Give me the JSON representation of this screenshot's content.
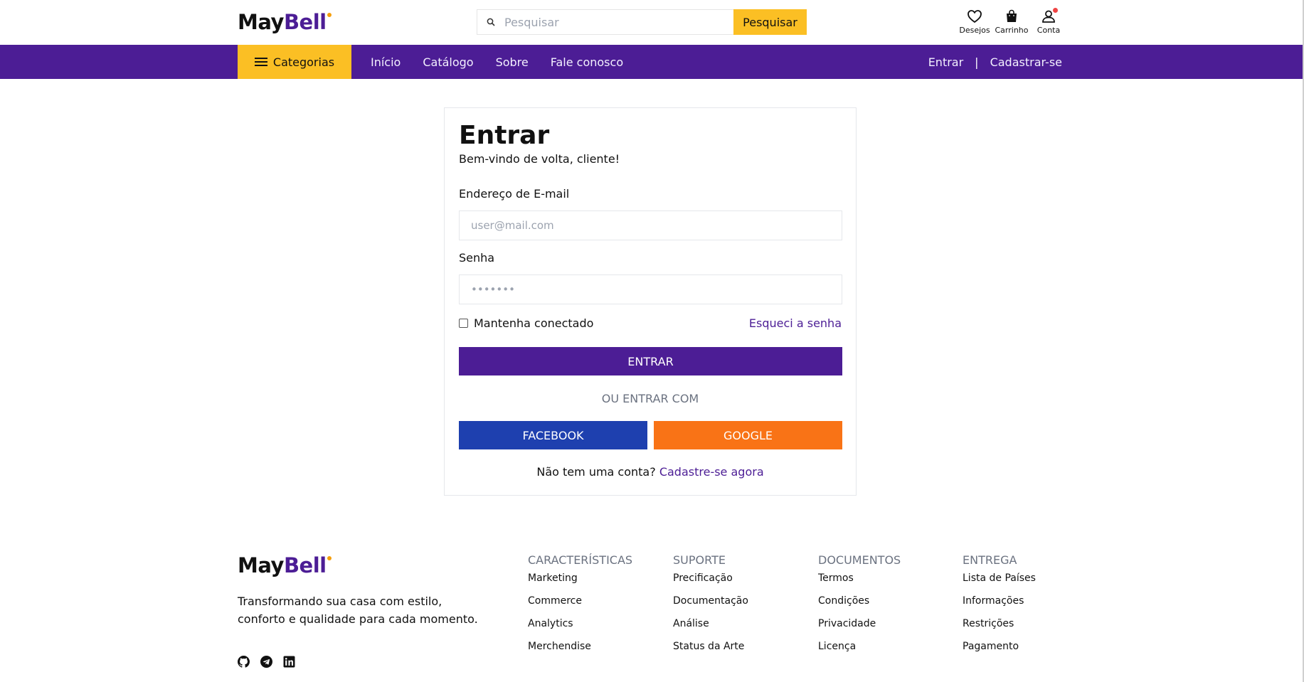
{
  "brand": {
    "name_part1": "May",
    "name_part2": "Bell"
  },
  "search": {
    "placeholder": "Pesquisar",
    "button_label": "Pesquisar"
  },
  "header_icons": [
    {
      "label": "Desejos",
      "icon": "heart-icon"
    },
    {
      "label": "Carrinho",
      "icon": "shopping-bag-icon"
    },
    {
      "label": "Conta",
      "icon": "user-icon"
    }
  ],
  "nav": {
    "categories_label": "Categorias",
    "links": [
      "Início",
      "Catálogo",
      "Sobre",
      "Fale conosco"
    ],
    "login_label": "Entrar",
    "separator": "|",
    "register_label": "Cadastrar-se"
  },
  "login": {
    "title": "Entrar",
    "welcome": "Bem-vindo de volta, cliente!",
    "email_label": "Endereço de E-mail",
    "email_placeholder": "user@mail.com",
    "password_label": "Senha",
    "password_placeholder": "•••••••",
    "remember_label": "Mantenha conectado",
    "forgot_label": "Esqueci a senha",
    "submit_label": "ENTRAR",
    "or_label": "OU ENTRAR COM",
    "facebook_label": "FACEBOOK",
    "google_label": "GOOGLE",
    "no_account_text": "Não tem uma conta?",
    "signup_link": "Cadastre-se agora"
  },
  "footer": {
    "tagline": "Transformando sua casa com estilo, conforto e qualidade para cada momento.",
    "socials": [
      "github-icon",
      "telegram-icon",
      "linkedin-icon"
    ],
    "columns": [
      {
        "title": "CARACTERÍSTICAS",
        "links": [
          "Marketing",
          "Commerce",
          "Analytics",
          "Merchendise"
        ]
      },
      {
        "title": "SUPORTE",
        "links": [
          "Precificação",
          "Documentação",
          "Análise",
          "Status da Arte"
        ]
      },
      {
        "title": "DOCUMENTOS",
        "links": [
          "Termos",
          "Condições",
          "Privacidade",
          "Licença"
        ]
      },
      {
        "title": "ENTREGA",
        "links": [
          "Lista de Países",
          "Informações",
          "Restrições",
          "Pagamento"
        ]
      }
    ]
  },
  "colors": {
    "primary": "#4c1d95",
    "accent": "#fbbf24",
    "facebook": "#1e40af",
    "google": "#f97316",
    "notification": "#ef4444"
  }
}
